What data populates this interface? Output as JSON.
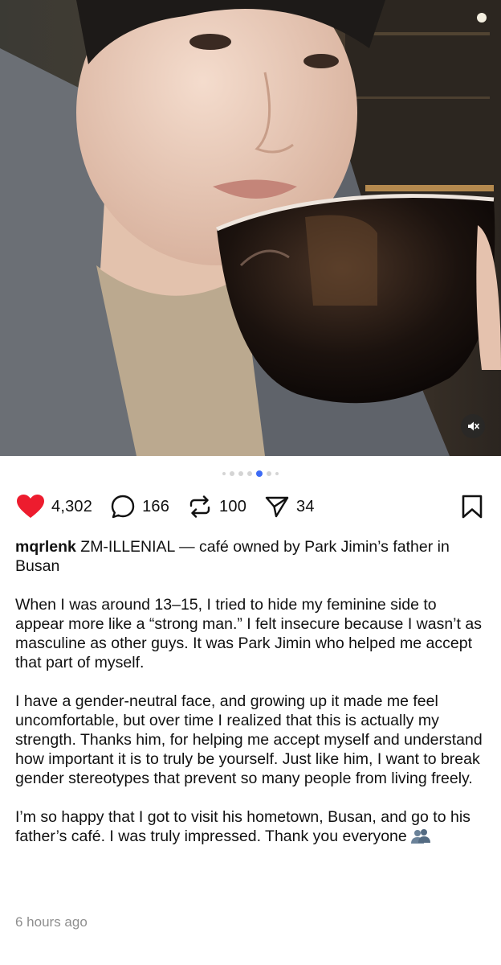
{
  "post": {
    "media": {
      "mute_icon": "speaker-muted-icon",
      "dots_total": 7,
      "active_dot": 4
    },
    "actions": {
      "likes": "4,302",
      "comments": "166",
      "reposts": "100",
      "shares": "34",
      "like_color": "#ed1c2e"
    },
    "caption": {
      "username": "mqrlenk",
      "headline": " ZM-ILLENIAL — café owned by Park Jimin’s father in Busan",
      "paragraph_1": "When I was around 13–15, I tried to hide my feminine side to appear more like a “strong man.” I felt insecure because I wasn’t as masculine as other guys. It was Park Jimin who helped me accept that part of myself.",
      "paragraph_2": "I have a gender-neutral face, and growing up it made me feel uncomfortable, but over time I realized that this is actually my strength. Thanks him, for helping me accept myself and understand how important it is to truly be yourself. Just like him, I want to break gender stereotypes that prevent so many people from living freely.",
      "paragraph_3": "I’m so happy that I got to visit his hometown, Busan, and go to his father’s café. I was truly impressed. Thank you everyone",
      "paragraph_3_emoji": "people-silhouette-emoji"
    },
    "timestamp": "6 hours ago"
  }
}
